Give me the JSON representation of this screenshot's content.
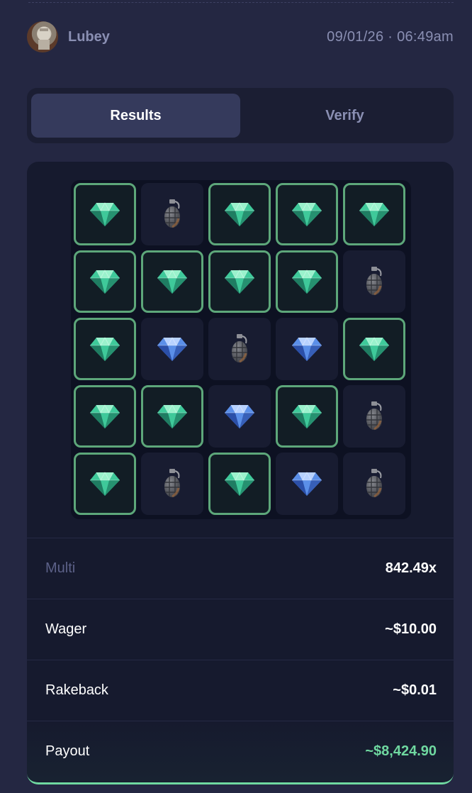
{
  "header": {
    "username": "Lubey",
    "timestamp": "09/01/26 · 06:49am"
  },
  "tabs": [
    {
      "label": "Results",
      "active": true
    },
    {
      "label": "Verify",
      "active": false
    }
  ],
  "board": {
    "tiles": [
      "gem-revealed",
      "mine",
      "gem-revealed",
      "gem-revealed",
      "gem-revealed",
      "gem-revealed",
      "gem-revealed",
      "gem-revealed",
      "gem-revealed",
      "mine",
      "gem-revealed",
      "gem-unrevealed",
      "mine",
      "gem-unrevealed",
      "gem-revealed",
      "gem-revealed",
      "gem-revealed",
      "gem-unrevealed",
      "gem-revealed",
      "mine",
      "gem-revealed",
      "mine",
      "gem-revealed",
      "gem-unrevealed",
      "mine"
    ],
    "colors": {
      "revealed_border": "#5da77a",
      "green_gem": "#3fc99a",
      "blue_gem": "#5b8fe8",
      "payout": "#6fd8a0"
    }
  },
  "stats": {
    "multi_label": "Multi",
    "multi_value": "842.49x",
    "wager_label": "Wager",
    "wager_value": "~$10.00",
    "rakeback_label": "Rakeback",
    "rakeback_value": "~$0.01",
    "payout_label": "Payout",
    "payout_value": "~$8,424.90"
  }
}
